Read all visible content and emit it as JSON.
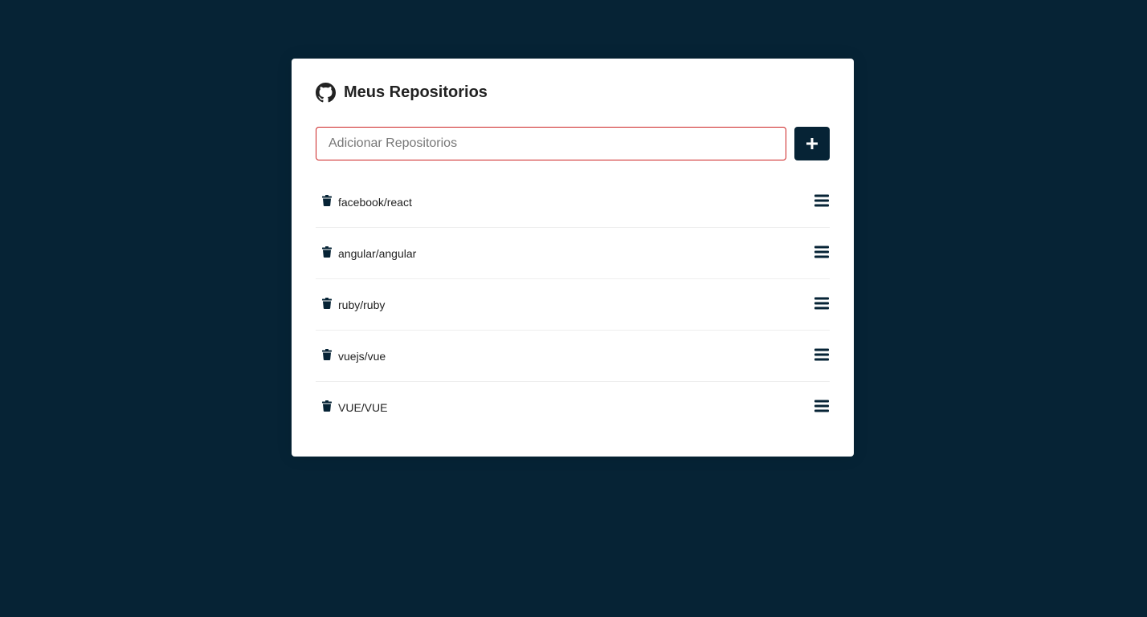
{
  "header": {
    "title": "Meus Repositorios",
    "icon": "github-icon"
  },
  "form": {
    "placeholder": "Adicionar Repositorios",
    "value": "",
    "add_label": "+",
    "input_border_color": "#cc2222"
  },
  "colors": {
    "background": "#062335",
    "card": "#ffffff",
    "accent": "#062335"
  },
  "repositories": [
    {
      "name": "facebook/react",
      "delete_icon": "trash-icon",
      "details_icon": "bars-icon"
    },
    {
      "name": "angular/angular",
      "delete_icon": "trash-icon",
      "details_icon": "bars-icon"
    },
    {
      "name": "ruby/ruby",
      "delete_icon": "trash-icon",
      "details_icon": "bars-icon"
    },
    {
      "name": "vuejs/vue",
      "delete_icon": "trash-icon",
      "details_icon": "bars-icon"
    },
    {
      "name": "VUE/VUE",
      "delete_icon": "trash-icon",
      "details_icon": "bars-icon"
    }
  ]
}
